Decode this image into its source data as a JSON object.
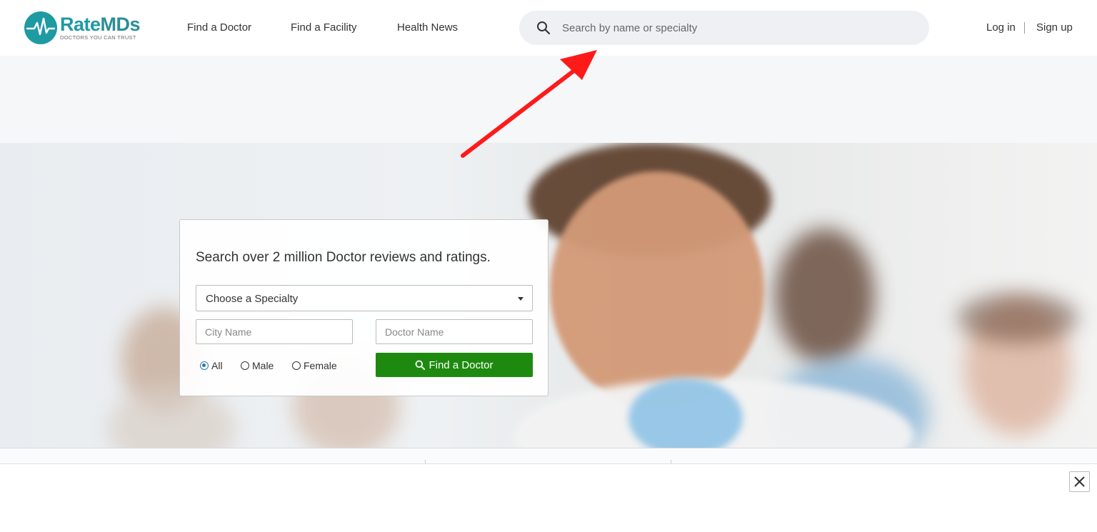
{
  "header": {
    "logo": {
      "name": "RateMDs",
      "name_a": "Rate",
      "name_b": "MDs",
      "tagline": "DOCTORS YOU CAN TRUST"
    },
    "nav": [
      {
        "label": "Find a Doctor"
      },
      {
        "label": "Find a Facility"
      },
      {
        "label": "Health News"
      }
    ],
    "search": {
      "placeholder": "Search by name or specialty",
      "value": ""
    },
    "login_label": "Log in",
    "signup_label": "Sign up"
  },
  "hero_card": {
    "title": "Search over 2 million Doctor reviews and ratings.",
    "specialty_select": {
      "selected": "Choose a Specialty"
    },
    "city_input": {
      "placeholder": "City Name",
      "value": ""
    },
    "doctor_input": {
      "placeholder": "Doctor Name",
      "value": ""
    },
    "gender_options": [
      {
        "label": "All",
        "selected": true
      },
      {
        "label": "Male",
        "selected": false
      },
      {
        "label": "Female",
        "selected": false
      }
    ],
    "submit_label": "Find a Doctor"
  },
  "colors": {
    "brand_teal": "#1e9aa3",
    "button_green": "#1d8a0f",
    "annotation_red": "#ff1a1a",
    "search_bg": "#eef0f4"
  },
  "icons": {
    "header_search": "search-icon",
    "button_search": "search-icon",
    "select_caret": "caret-down-icon",
    "close": "close-icon",
    "annotation": "red-arrow-annotation"
  }
}
